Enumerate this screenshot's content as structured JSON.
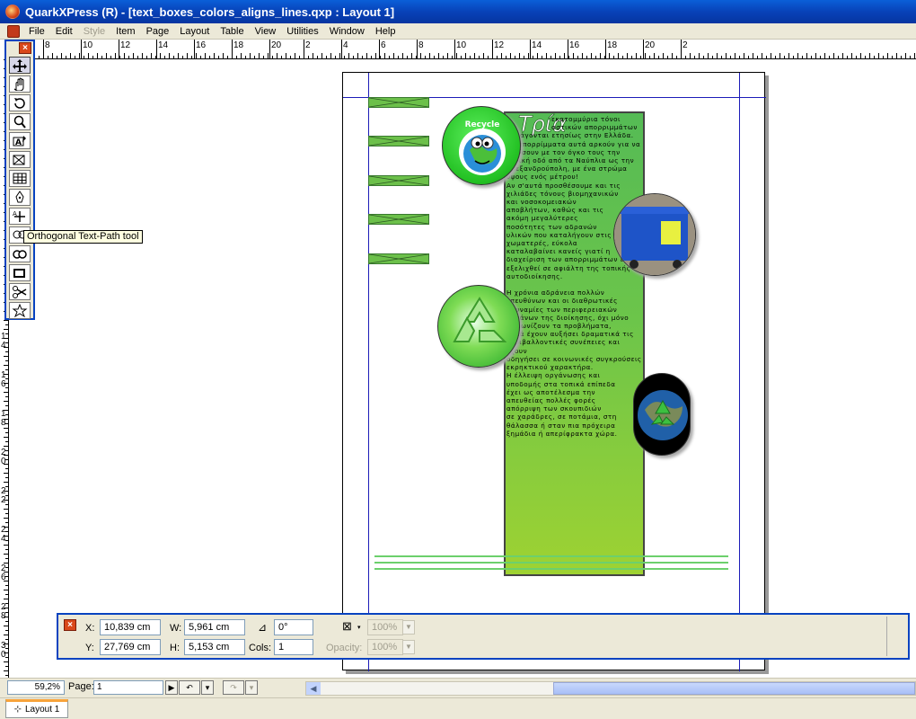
{
  "window": {
    "title": "QuarkXPress (R) - [text_boxes_colors_aligns_lines.qxp : Layout 1]"
  },
  "menu": [
    {
      "label": "File",
      "enabled": true
    },
    {
      "label": "Edit",
      "enabled": true
    },
    {
      "label": "Style",
      "enabled": false
    },
    {
      "label": "Item",
      "enabled": true
    },
    {
      "label": "Page",
      "enabled": true
    },
    {
      "label": "Layout",
      "enabled": true
    },
    {
      "label": "Table",
      "enabled": true
    },
    {
      "label": "View",
      "enabled": true
    },
    {
      "label": "Utilities",
      "enabled": true
    },
    {
      "label": "Window",
      "enabled": true
    },
    {
      "label": "Help",
      "enabled": true
    }
  ],
  "ruler_top": {
    "labels": [
      "8",
      "10",
      "12",
      "14",
      "16",
      "18",
      "20",
      "2",
      "4",
      "6",
      "8",
      "10",
      "12",
      "14",
      "16",
      "18",
      "20",
      "2"
    ]
  },
  "ruler_left": {
    "labels": [
      "1",
      "4",
      "1",
      "6",
      "1",
      "8",
      "2",
      "0",
      "2",
      "2",
      "2",
      "4",
      "2",
      "6",
      "2",
      "8",
      "3",
      "0"
    ]
  },
  "toolbox": {
    "tools": [
      {
        "name": "item-tool-icon",
        "active": true
      },
      {
        "name": "pan-tool-icon",
        "active": false
      },
      {
        "name": "rotation-tool-icon",
        "active": false
      },
      {
        "name": "zoom-tool-icon",
        "active": false
      },
      {
        "name": "text-content-tool-icon",
        "active": false
      },
      {
        "name": "picture-box-tool-icon",
        "active": false
      },
      {
        "name": "table-tool-icon",
        "active": false
      },
      {
        "name": "bezier-pen-tool-icon",
        "active": false
      },
      {
        "name": "orthogonal-line-tool-icon",
        "active": false
      },
      {
        "name": "orthogonal-text-path-tool-icon",
        "active": false
      },
      {
        "name": "linking-tool-icon",
        "active": false
      },
      {
        "name": "composition-zone-tool-icon",
        "active": false
      },
      {
        "name": "scissors-tool-icon",
        "active": false
      },
      {
        "name": "starburst-tool-icon",
        "active": false
      }
    ],
    "tooltip": "Orthogonal Text-Path tool"
  },
  "document": {
    "heading": "Τρία",
    "body_lines": [
      "εκατομμύρια τόνοι",
      "αστικών απορριμμάτων",
      "παράγονται ετησίως στην Ελλάδα.",
      "Τα απορρίμματα αυτά αρκούν για να",
      "γεμίσουν με τον όγκο τους την",
      "εθνική οδό από τα Ναύπλια ως την",
      "Αλεξανδρούπολη, με ένα στρώμα",
      "ύψους ενός μέτρου!",
      "Αν σ'αυτά προσθέσουμε και τις",
      "χιλιάδες τόνους βιομηχανικών",
      "και νοσοκομειακών",
      "αποβλήτων, καθώς και τις",
      "ακόμη μεγαλύτερες",
      "ποσότητες των αδρανών",
      "υλικών που καταλήγουν στις",
      "χωματερές, εύκολα",
      "καταλαβαίνει κανείς γιατί η",
      "διαχείριση των απορριμμάτων έχει",
      "εξελιχθεί σε αφιάλτη της τοπικής",
      "αυτοδιοίκησης.",
      "",
      "Η χρόνια αδράνεια πολλών",
      "υπευθύνων και οι διαθρωτικές",
      "αδυναμίες των περιφερειακών",
      "οργάνων της διοίκησης, όχι μόνο",
      "διαιωνίζουν τα προβλήματα,",
      "αλλά έχουν αυξήσει δραματικά τις",
      "περιβαλλοντικές συνέπειες και έχουν",
      "οδηγήσει σε κοινωνικές συγκρούσεις",
      "εκρηκτικού χαρακτήρα.",
      "Η έλλειψη οργάνωσης και",
      "υποδομής στα τοπικά επίπεδα",
      "έχει ως αποτέλεσμα την",
      "απευθείας πολλές φορές",
      "απόρριψη των σκουπιδιών",
      "σε χαράδρες, σε ποτάμια, στη",
      "θάλασσα ή σταν πια πρόχειρα",
      "ξημάδια ή απερίφρακτα χώρα."
    ],
    "logo_text": "Recycle"
  },
  "measurements": {
    "x_label": "X:",
    "x_value": "10,839 cm",
    "y_label": "Y:",
    "y_value": "27,769 cm",
    "w_label": "W:",
    "w_value": "5,961 cm",
    "h_label": "H:",
    "h_value": "5,153 cm",
    "angle_value": "0°",
    "cols_label": "Cols:",
    "cols_value": "1",
    "opacity_top_value": "100%",
    "opacity_label": "Opacity:",
    "opacity_value": "100%"
  },
  "statusbar": {
    "zoom": "59,2%",
    "page_label": "Page:",
    "page_value": "1"
  },
  "tabs": [
    {
      "label": "Layout 1",
      "active": true
    }
  ],
  "colors": {
    "titlebar": "#0842b8",
    "chrome": "#ece9d8",
    "guide": "#1c1cb8",
    "green_top": "#55bb55",
    "green_bottom": "#9ed232",
    "lines": "#6cd06c"
  }
}
